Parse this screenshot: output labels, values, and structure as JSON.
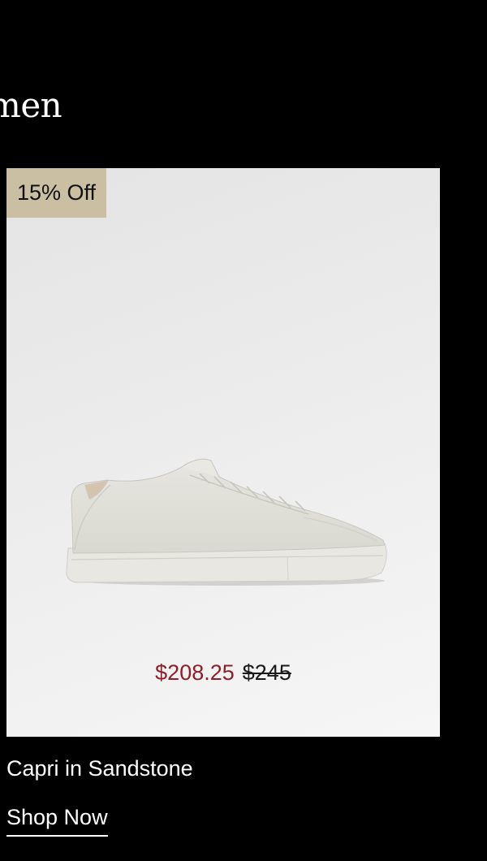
{
  "header": {
    "title": "men"
  },
  "product": {
    "badge": "15% Off",
    "sale_price": "$208.25",
    "original_price": "$245",
    "name": "Capri in Sandstone",
    "cta": "Shop Now",
    "image_icon": "sneaker-image"
  },
  "colors": {
    "background": "#000000",
    "badge": "#cbbfa3",
    "sale_price": "#8f1e2a"
  }
}
